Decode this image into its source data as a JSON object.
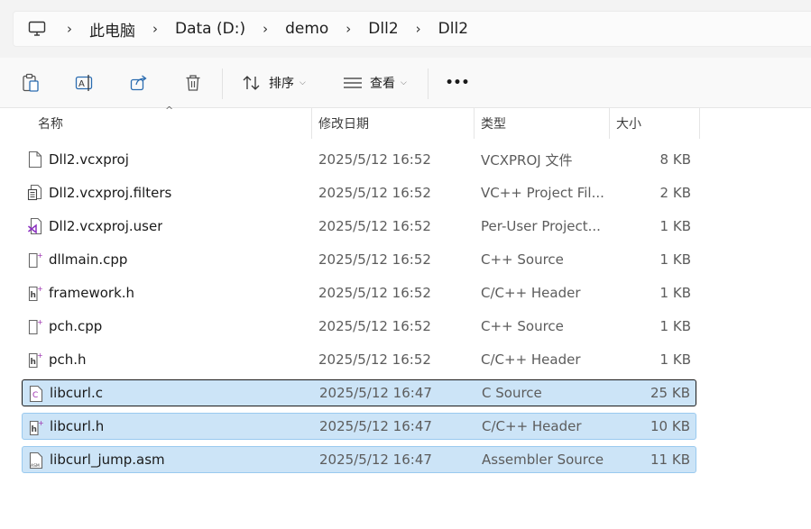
{
  "breadcrumb": {
    "icon": "computer-icon",
    "items": [
      "此电脑",
      "Data (D:)",
      "demo",
      "Dll2",
      "Dll2"
    ]
  },
  "toolbar": {
    "sort_label": "排序",
    "view_label": "查看",
    "more_label": "•••"
  },
  "columns": {
    "name": "名称",
    "date": "修改日期",
    "type": "类型",
    "size": "大小"
  },
  "files": [
    {
      "name": "Dll2.vcxproj",
      "date": "2025/5/12 16:52",
      "type": "VCXPROJ 文件",
      "size": "8 KB",
      "icon": "blank-file-icon",
      "selected": false
    },
    {
      "name": "Dll2.vcxproj.filters",
      "date": "2025/5/12 16:52",
      "type": "VC++ Project Fil...",
      "size": "2 KB",
      "icon": "filters-file-icon",
      "selected": false
    },
    {
      "name": "Dll2.vcxproj.user",
      "date": "2025/5/12 16:52",
      "type": "Per-User Project...",
      "size": "1 KB",
      "icon": "vs-user-file-icon",
      "selected": false
    },
    {
      "name": "dllmain.cpp",
      "date": "2025/5/12 16:52",
      "type": "C++ Source",
      "size": "1 KB",
      "icon": "cpp-file-icon",
      "selected": false
    },
    {
      "name": "framework.h",
      "date": "2025/5/12 16:52",
      "type": "C/C++ Header",
      "size": "1 KB",
      "icon": "header-file-icon",
      "selected": false
    },
    {
      "name": "pch.cpp",
      "date": "2025/5/12 16:52",
      "type": "C++ Source",
      "size": "1 KB",
      "icon": "cpp-file-icon",
      "selected": false
    },
    {
      "name": "pch.h",
      "date": "2025/5/12 16:52",
      "type": "C/C++ Header",
      "size": "1 KB",
      "icon": "header-file-icon",
      "selected": false
    },
    {
      "name": "libcurl.c",
      "date": "2025/5/12 16:47",
      "type": "C Source",
      "size": "25 KB",
      "icon": "c-file-icon",
      "selected": true
    },
    {
      "name": "libcurl.h",
      "date": "2025/5/12 16:47",
      "type": "C/C++ Header",
      "size": "10 KB",
      "icon": "header-file-icon",
      "selected": true
    },
    {
      "name": "libcurl_jump.asm",
      "date": "2025/5/12 16:47",
      "type": "Assembler Source",
      "size": "11 KB",
      "icon": "asm-file-icon",
      "selected": true
    }
  ]
}
